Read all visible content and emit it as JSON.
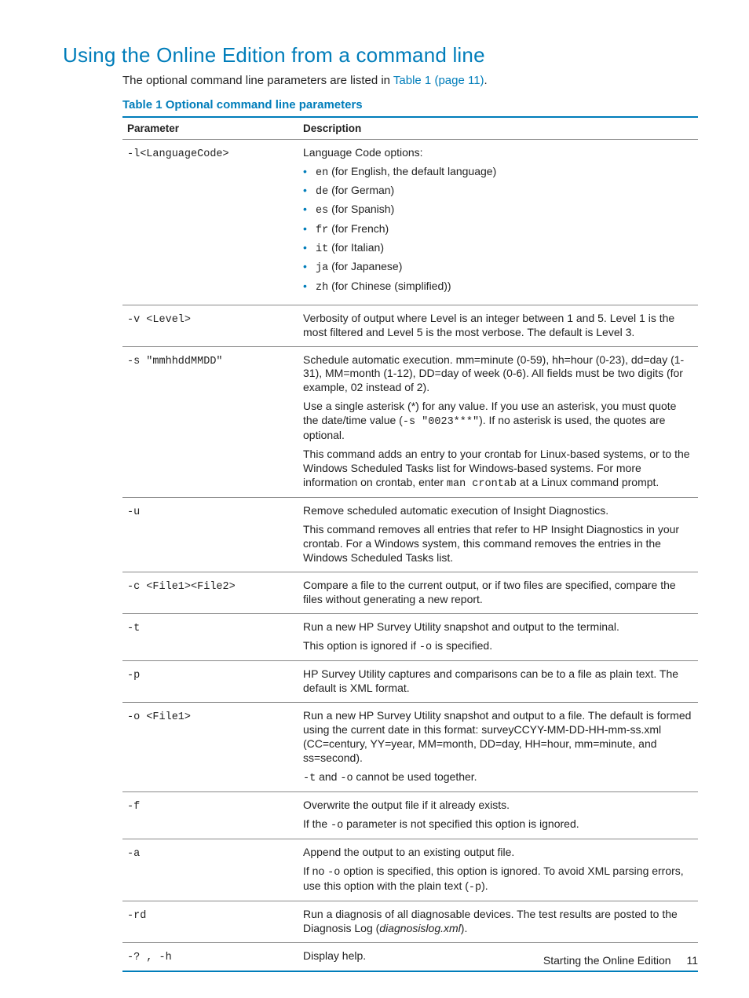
{
  "heading": "Using the Online Edition from a command line",
  "intro_prefix": "The optional command line parameters are listed in ",
  "intro_link": "Table 1 (page 11)",
  "intro_suffix": ".",
  "table_caption": "Table 1 Optional command line parameters",
  "col_param": "Parameter",
  "col_desc": "Description",
  "rows": {
    "r0": {
      "param": "-l<LanguageCode>",
      "lead": "Language Code options:",
      "opts": [
        {
          "c": "en",
          "t": " (for English, the default language)"
        },
        {
          "c": "de",
          "t": " (for German)"
        },
        {
          "c": "es",
          "t": " (for Spanish)"
        },
        {
          "c": "fr",
          "t": " (for French)"
        },
        {
          "c": "it",
          "t": " (for Italian)"
        },
        {
          "c": "ja",
          "t": " (for Japanese)"
        },
        {
          "c": "zh",
          "t": " (for Chinese (simplified))"
        }
      ]
    },
    "r1": {
      "param": "-v <Level>",
      "desc": "Verbosity of output where Level is an integer between 1 and 5. Level 1 is the most filtered and Level 5 is the most verbose. The default is Level 3."
    },
    "r2": {
      "param": "-s \"mmhhddMMDD\"",
      "p1": "Schedule automatic execution. mm=minute (0-59), hh=hour (0-23), dd=day (1-31), MM=month (1-12), DD=day of week (0-6). All fields must be two digits (for example, 02 instead of 2).",
      "p2a": "Use a single asterisk (*) for any value. If you use an asterisk, you must quote the date/time value (",
      "p2code": "-s \"0023***\"",
      "p2b": "). If no asterisk is used, the quotes are optional.",
      "p3a": "This command adds an entry to your crontab for Linux-based systems, or to the Windows Scheduled Tasks list for Windows-based systems. For more information on crontab, enter ",
      "p3code": "man crontab",
      "p3b": " at a Linux command prompt."
    },
    "r3": {
      "param": "-u",
      "p1": "Remove scheduled automatic execution of Insight Diagnostics.",
      "p2": "This command removes all entries that refer to HP Insight Diagnostics in your crontab. For a Windows system, this command removes the entries in the Windows Scheduled Tasks list."
    },
    "r4": {
      "param": "-c <File1><File2>",
      "desc": "Compare a file to the current output, or if two files are specified, compare the files without generating a new report."
    },
    "r5": {
      "param": "-t",
      "p1": "Run a new HP Survey Utility snapshot and output to the terminal.",
      "p2a": "This option is ignored if ",
      "p2code": "-o",
      "p2b": " is specified."
    },
    "r6": {
      "param": "-p",
      "desc": "HP Survey Utility captures and comparisons can be to a file as plain text. The default is XML format."
    },
    "r7": {
      "param": "-o <File1>",
      "p1": "Run a new HP Survey Utility snapshot and output to a file. The default is formed using the current date in this format: surveyCCYY-MM-DD-HH-mm-ss.xml (CC=century, YY=year, MM=month, DD=day, HH=hour, mm=minute, and ss=second).",
      "p2code1": "-t",
      "p2mid": " and ",
      "p2code2": "-o",
      "p2b": " cannot be used together."
    },
    "r8": {
      "param": "-f",
      "p1": "Overwrite the output file if it already exists.",
      "p2a": "If the ",
      "p2code": "-o",
      "p2b": " parameter is not specified this option is ignored."
    },
    "r9": {
      "param": "-a",
      "p1": "Append the output to an existing output file.",
      "p2a": "If no ",
      "p2code1": "-o",
      "p2mid": " option is specified, this option is ignored. To avoid XML parsing errors, use this option with the plain text (",
      "p2code2": "-p",
      "p2b": ")."
    },
    "r10": {
      "param": "-rd",
      "desc_a": "Run a diagnosis of all diagnosable devices. The test results are posted to the Diagnosis Log (",
      "desc_fname": "diagnosislog.xml",
      "desc_b": ")."
    },
    "r11": {
      "param": "-? , -h",
      "desc": "Display help."
    }
  },
  "footer_title": "Starting the Online Edition",
  "footer_page": "11"
}
